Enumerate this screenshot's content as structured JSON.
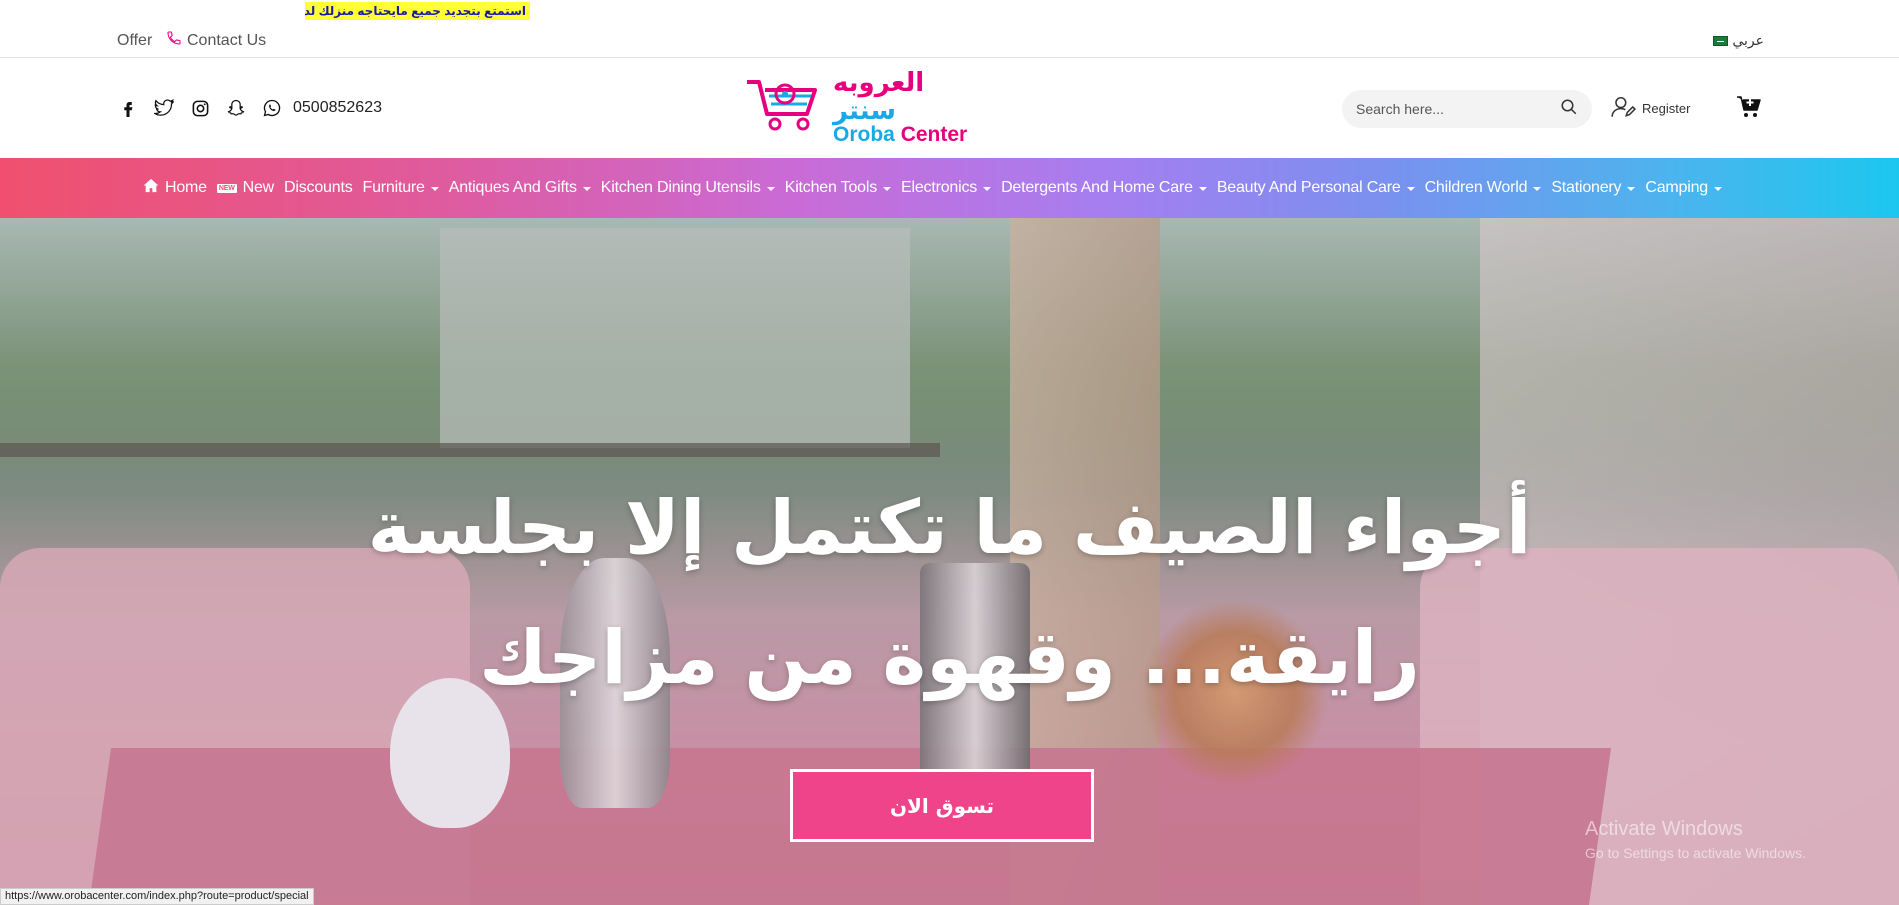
{
  "marquee": {
    "text": "استمتع بتجديد جميع مايحتاجه منزلك لدى"
  },
  "topbar": {
    "offer": "Offer",
    "contact": "Contact Us",
    "language": "عربي"
  },
  "header": {
    "phone": "0500852623",
    "logo_ar_1": "العروبه",
    "logo_ar_2": "سنتر",
    "logo_en_1": "Oroba",
    "logo_en_2": "Center",
    "search_placeholder": "Search here...",
    "register": "Register"
  },
  "nav": {
    "items": [
      {
        "label": "Home",
        "icon": "home-icon",
        "dropdown": false
      },
      {
        "label": "New",
        "icon": "new-badge-icon",
        "badge": "NEW",
        "dropdown": false
      },
      {
        "label": "Discounts",
        "dropdown": false
      },
      {
        "label": "Furniture",
        "dropdown": true
      },
      {
        "label": "Antiques And Gifts",
        "dropdown": true
      },
      {
        "label": "Kitchen Dining Utensils",
        "dropdown": true
      },
      {
        "label": "Kitchen Tools",
        "dropdown": true
      },
      {
        "label": "Electronics",
        "dropdown": true
      },
      {
        "label": "Detergents And Home Care",
        "dropdown": true
      },
      {
        "label": "Beauty And Personal Care",
        "dropdown": true
      },
      {
        "label": "Children World",
        "dropdown": true
      },
      {
        "label": "Stationery",
        "dropdown": true
      },
      {
        "label": "Camping",
        "dropdown": true
      }
    ]
  },
  "hero": {
    "title_line1": "أجواء الصيف ما تكتمل إلا بجلسة",
    "title_line2": "رايقة... وقهوة من مزاجك",
    "button": "تسوق الان"
  },
  "overlay": {
    "activate_title": "Activate Windows",
    "activate_sub": "Go to Settings to activate Windows.",
    "status_url": "https://www.orobacenter.com/index.php?route=product/special"
  },
  "colors": {
    "brand_pink": "#e6007e",
    "brand_blue": "#19a9e5",
    "button": "#f0448a"
  }
}
